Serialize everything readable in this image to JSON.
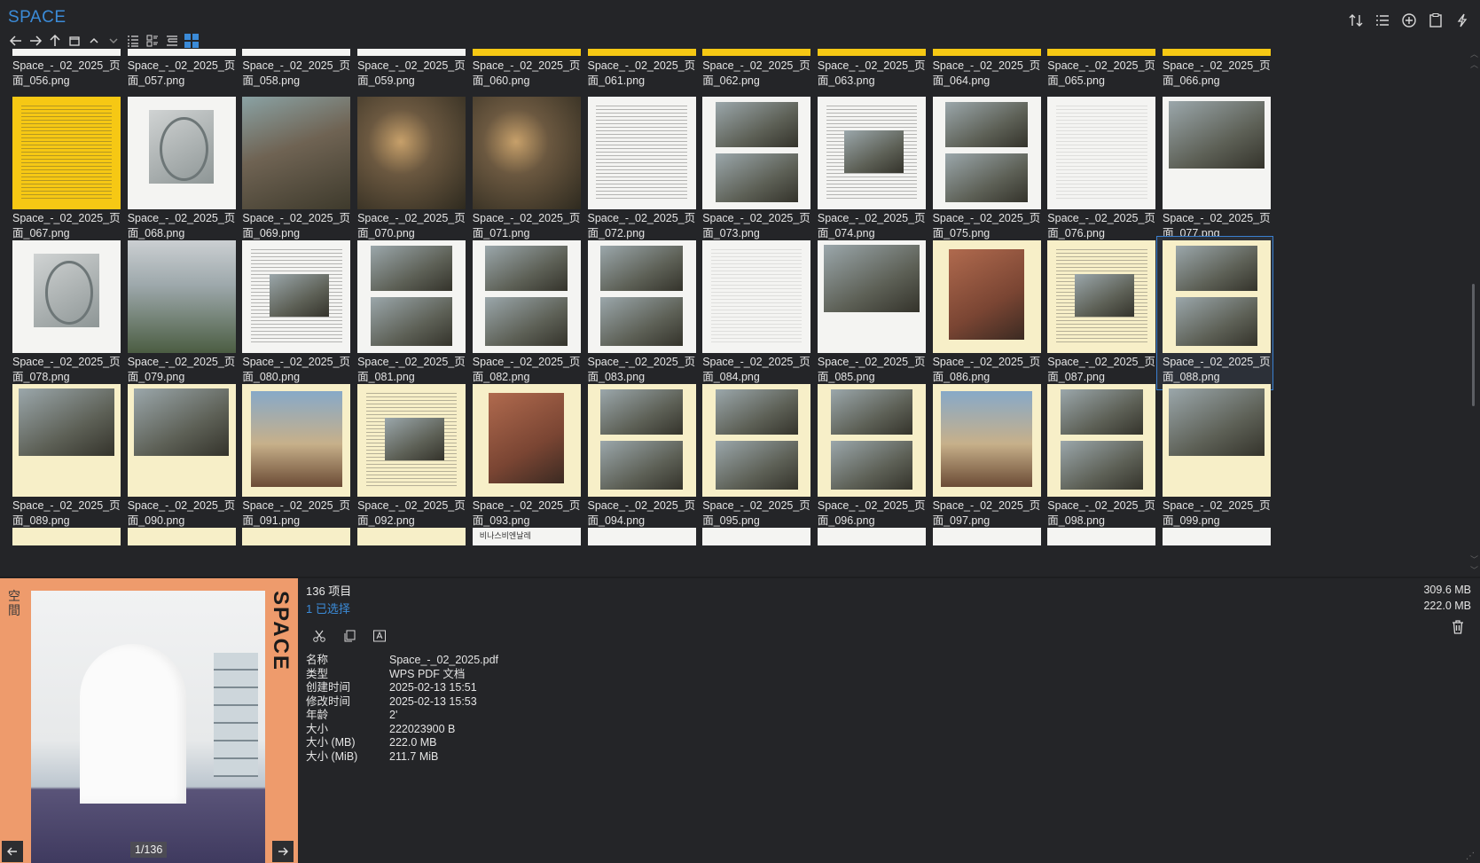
{
  "app": {
    "title": "SPACE"
  },
  "toolbar": {
    "nav": [
      "back-arrow-icon",
      "forward-arrow-icon",
      "up-arrow-icon",
      "window-icon",
      "chevron-up-icon",
      "chevron-down-icon",
      "list-view-icon",
      "detail-view-icon",
      "tree-view-icon",
      "grid-view-icon"
    ],
    "right": [
      "sort-icon",
      "properties-icon",
      "add-circle-icon",
      "clipboard-icon",
      "quick-action-icon"
    ]
  },
  "grid": {
    "rows": [
      {
        "kind": "top",
        "files": [
          "Space_-_02_2025_页\n面_056.png",
          "Space_-_02_2025_页\n面_057.png",
          "Space_-_02_2025_页\n面_058.png",
          "Space_-_02_2025_页\n面_059.png",
          "Space_-_02_2025_页\n面_060.png",
          "Space_-_02_2025_页\n面_061.png",
          "Space_-_02_2025_页\n面_062.png",
          "Space_-_02_2025_页\n面_063.png",
          "Space_-_02_2025_页\n面_064.png",
          "Space_-_02_2025_页\n面_065.png",
          "Space_-_02_2025_页\n面_066.png"
        ],
        "thumbs": [
          "bg-white",
          "bg-white",
          "bg-white",
          "bg-white",
          "bg-yellow",
          "bg-yellow",
          "bg-yellow",
          "bg-yellow",
          "bg-yellow",
          "bg-yellow",
          "bg-yellow"
        ]
      },
      {
        "kind": "full",
        "files": [
          "Space_-_02_2025_页\n面_067.png",
          "Space_-_02_2025_页\n面_068.png",
          "Space_-_02_2025_页\n面_069.png",
          "Space_-_02_2025_页\n面_070.png",
          "Space_-_02_2025_页\n面_071.png",
          "Space_-_02_2025_页\n面_072.png",
          "Space_-_02_2025_页\n面_073.png",
          "Space_-_02_2025_页\n面_074.png",
          "Space_-_02_2025_页\n面_075.png",
          "Space_-_02_2025_页\n面_076.png",
          "Space_-_02_2025_页\n面_077.png"
        ],
        "thumbs": [
          "yellow-text",
          "white-ring",
          "photo-a",
          "photo-b",
          "photo-b",
          "white-text",
          "white-2pics",
          "white-text-pic",
          "white-2pics",
          "white-drawing",
          "white-photo"
        ]
      },
      {
        "kind": "full",
        "files": [
          "Space_-_02_2025_页\n面_078.png",
          "Space_-_02_2025_页\n面_079.png",
          "Space_-_02_2025_页\n面_080.png",
          "Space_-_02_2025_页\n面_081.png",
          "Space_-_02_2025_页\n面_082.png",
          "Space_-_02_2025_页\n面_083.png",
          "Space_-_02_2025_页\n面_084.png",
          "Space_-_02_2025_页\n面_085.png",
          "Space_-_02_2025_页\n面_086.png",
          "Space_-_02_2025_页\n面_087.png",
          "Space_-_02_2025_页\n面_088.png"
        ],
        "thumbs": [
          "white-ring",
          "photo-c",
          "white-text-pic",
          "white-2pics",
          "white-2pics",
          "white-2pics",
          "white-drawing",
          "white-photo",
          "cream-brick",
          "cream-text-pic",
          "cream-2pics"
        ]
      },
      {
        "kind": "full",
        "files": [
          "Space_-_02_2025_页\n面_089.png",
          "Space_-_02_2025_页\n面_090.png",
          "Space_-_02_2025_页\n面_091.png",
          "Space_-_02_2025_页\n面_092.png",
          "Space_-_02_2025_页\n面_093.png",
          "Space_-_02_2025_页\n面_094.png",
          "Space_-_02_2025_页\n面_095.png",
          "Space_-_02_2025_页\n面_096.png",
          "Space_-_02_2025_页\n面_097.png",
          "Space_-_02_2025_页\n面_098.png",
          "Space_-_02_2025_页\n面_099.png"
        ],
        "thumbs": [
          "cream-photo",
          "cream-photo",
          "cream-sky",
          "cream-text-pic",
          "cream-brick",
          "cream-2pics",
          "cream-2pics",
          "cream-2pics",
          "cream-sky",
          "cream-2pics",
          "cream-photo"
        ]
      },
      {
        "kind": "bottom",
        "thumbs": [
          "bg-cream",
          "bg-cream",
          "bg-cream",
          "bg-cream",
          "bg-white",
          "bg-white",
          "bg-white",
          "bg-white",
          "bg-white",
          "bg-white",
          "bg-white"
        ]
      }
    ],
    "selected": "Space_-_02_2025_页\n面_088.png",
    "partial_text": "비나스비엔날레"
  },
  "preview": {
    "cover_logo": "SPACE",
    "cover_side_text": "空\n間",
    "page_counter": "1/136"
  },
  "info": {
    "count": "136 项目",
    "selected": "1 已选择",
    "props": [
      {
        "k": "名称",
        "v": "Space_-_02_2025.pdf"
      },
      {
        "k": "类型",
        "v": "WPS PDF 文档"
      },
      {
        "k": "创建时间",
        "v": "2025-02-13  15:51"
      },
      {
        "k": "修改时间",
        "v": "2025-02-13  15:53"
      },
      {
        "k": "年龄",
        "v": "2'"
      },
      {
        "k": "大小",
        "v": "222023900 B"
      },
      {
        "k": "大小 (MB)",
        "v": "222.0 MB"
      },
      {
        "k": "大小 (MiB)",
        "v": "211.7 MiB"
      }
    ],
    "total_size": "309.6 MB",
    "selected_size": "222.0 MB"
  },
  "colors": {
    "accent": "#3b8bd8",
    "background": "#242528",
    "preview_bg": "#ee9b6c"
  }
}
